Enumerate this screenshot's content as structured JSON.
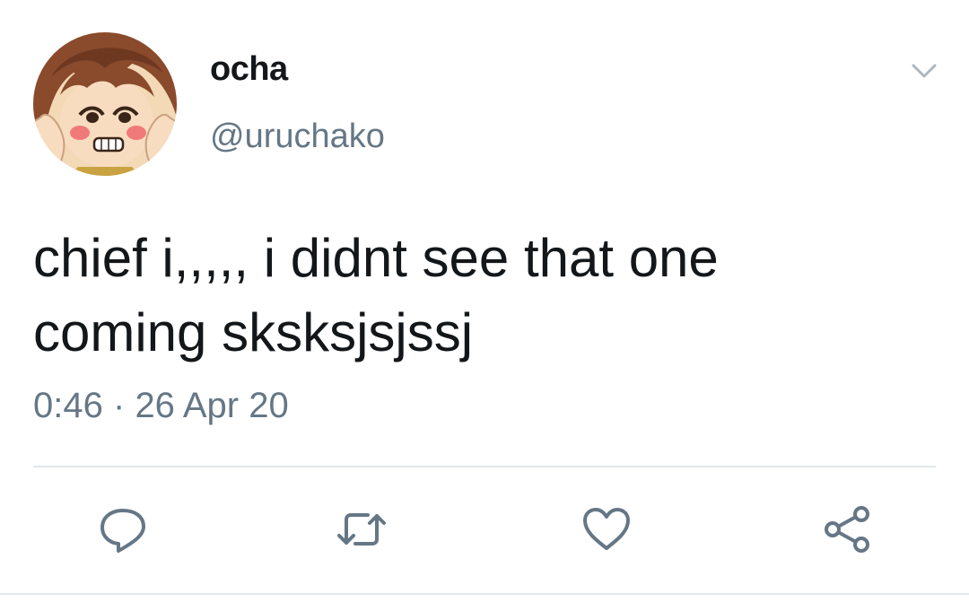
{
  "tweet": {
    "display_name": "ocha",
    "handle": "@uruchako",
    "text_lines": [
      "chief i,,,,, i didnt see that one",
      "coming sksksjsjssj"
    ],
    "time": "0:46",
    "separator": "·",
    "date": "26 Apr 20"
  },
  "icons": {
    "caret": "chevron-down-icon",
    "reply": "reply-icon",
    "retweet": "retweet-icon",
    "like": "heart-icon",
    "share": "share-icon"
  },
  "colors": {
    "text": "#14171a",
    "secondary": "#657786",
    "divider": "#e1e8ed"
  }
}
